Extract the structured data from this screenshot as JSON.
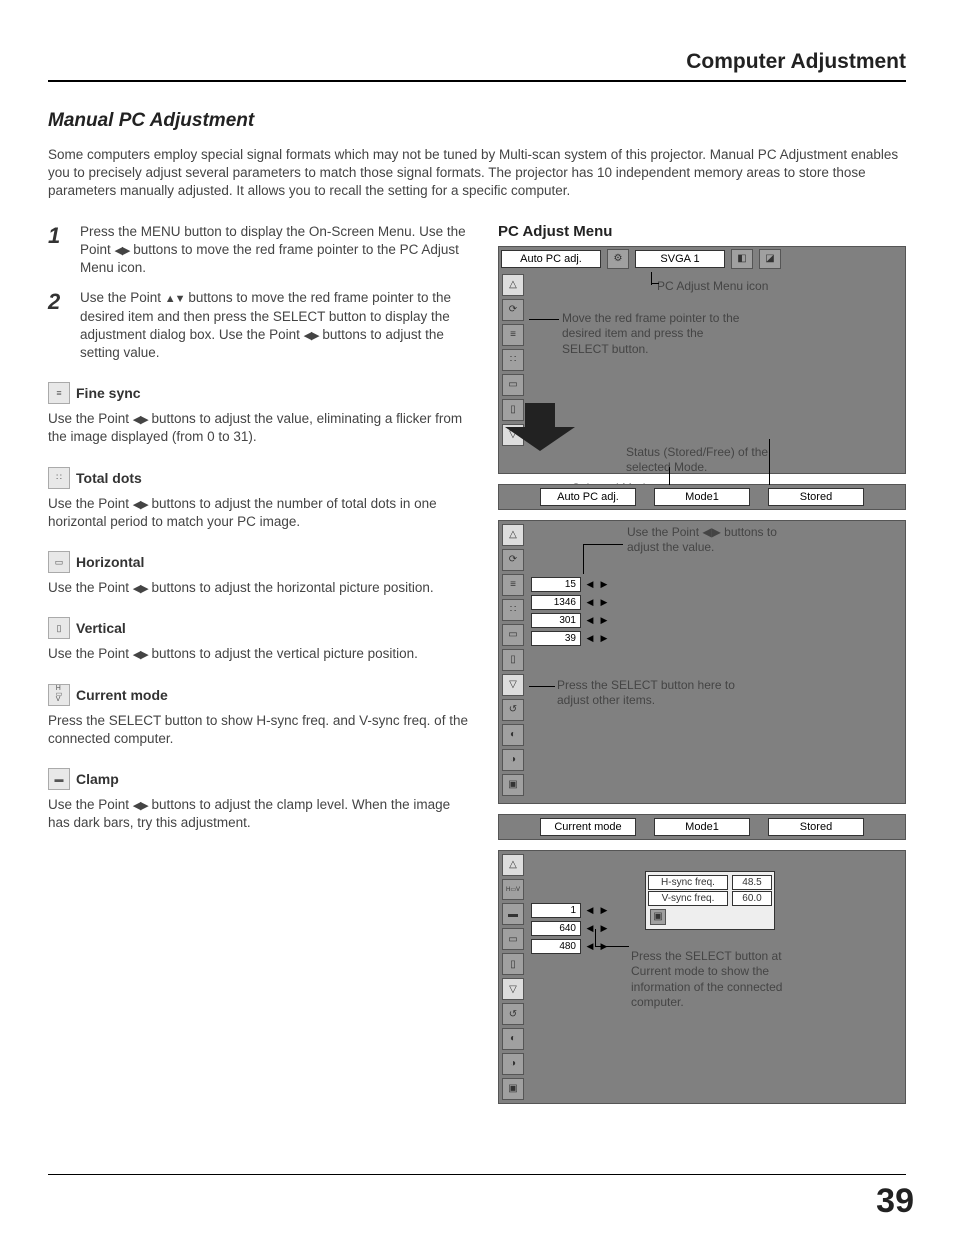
{
  "header": {
    "title": "Computer Adjustment"
  },
  "section": {
    "title": "Manual PC Adjustment"
  },
  "intro": "Some computers employ special signal formats which may not be tuned by Multi-scan system of this projector. Manual PC Adjustment enables you to precisely adjust several parameters to match those signal formats. The projector has 10 independent memory areas to store those parameters manually adjusted. It allows you to recall the setting for a specific computer.",
  "steps": [
    {
      "num": "1",
      "text_a": "Press the MENU button to display the On-Screen Menu. Use the Point ",
      "text_b": " buttons to move the red frame pointer to the PC Adjust Menu icon."
    },
    {
      "num": "2",
      "text_a": "Use the Point ",
      "text_b": " buttons to move the red frame pointer to the desired item and then press the SELECT button to display the adjustment dialog box. Use the Point ",
      "text_c": " buttons to adjust the setting value."
    }
  ],
  "subsections": [
    {
      "title": "Fine sync",
      "icon": "fine-sync",
      "desc_a": "Use the Point ",
      "desc_b": " buttons to adjust the value, eliminating a flicker from the image displayed (from 0 to 31)."
    },
    {
      "title": "Total dots",
      "icon": "total-dots",
      "desc_a": "Use the Point ",
      "desc_b": " buttons to adjust the number of total dots in one horizontal period to match your PC image."
    },
    {
      "title": "Horizontal",
      "icon": "horizontal",
      "desc_a": "Use the Point ",
      "desc_b": " buttons to adjust the horizontal picture position."
    },
    {
      "title": "Vertical",
      "icon": "vertical",
      "desc_a": "Use the Point ",
      "desc_b": " buttons to adjust the vertical picture position."
    },
    {
      "title": "Current mode",
      "icon": "current-mode",
      "desc_plain": "Press the SELECT button to show H-sync freq. and V-sync freq. of the connected computer."
    },
    {
      "title": "Clamp",
      "icon": "clamp",
      "desc_a": "Use the Point ",
      "desc_b": " buttons to adjust the clamp level. When the image has dark bars, try this adjustment."
    }
  ],
  "right": {
    "title": "PC Adjust Menu",
    "osd_top": {
      "label": "Auto PC adj.",
      "resolution": "SVGA 1"
    },
    "annot_icon": "PC Adjust Menu icon",
    "annot_move": "Move the red frame pointer to the desired item and press the SELECT button.",
    "annot_status": "Status (Stored/Free) of the selected Mode.",
    "annot_selected": "Selected Mode",
    "status_bar1": {
      "left": "Auto PC adj.",
      "mid": "Mode1",
      "right": "Stored"
    },
    "annot_adjust": "Use the Point ◀▶ buttons to adjust the value.",
    "values": [
      "15",
      "1346",
      "301",
      "39"
    ],
    "annot_select_here": "Press the SELECT button here to adjust other items.",
    "status_bar2": {
      "left": "Current mode",
      "mid": "Mode1",
      "right": "Stored"
    },
    "values2": [
      "1",
      "640",
      "480"
    ],
    "sync_panel": {
      "h_label": "H-sync freq.",
      "h_val": "48.5",
      "v_label": "V-sync freq.",
      "v_val": "60.0"
    },
    "annot_current": "Press the SELECT button at Current mode to show the information of the connected computer."
  },
  "page": "39"
}
